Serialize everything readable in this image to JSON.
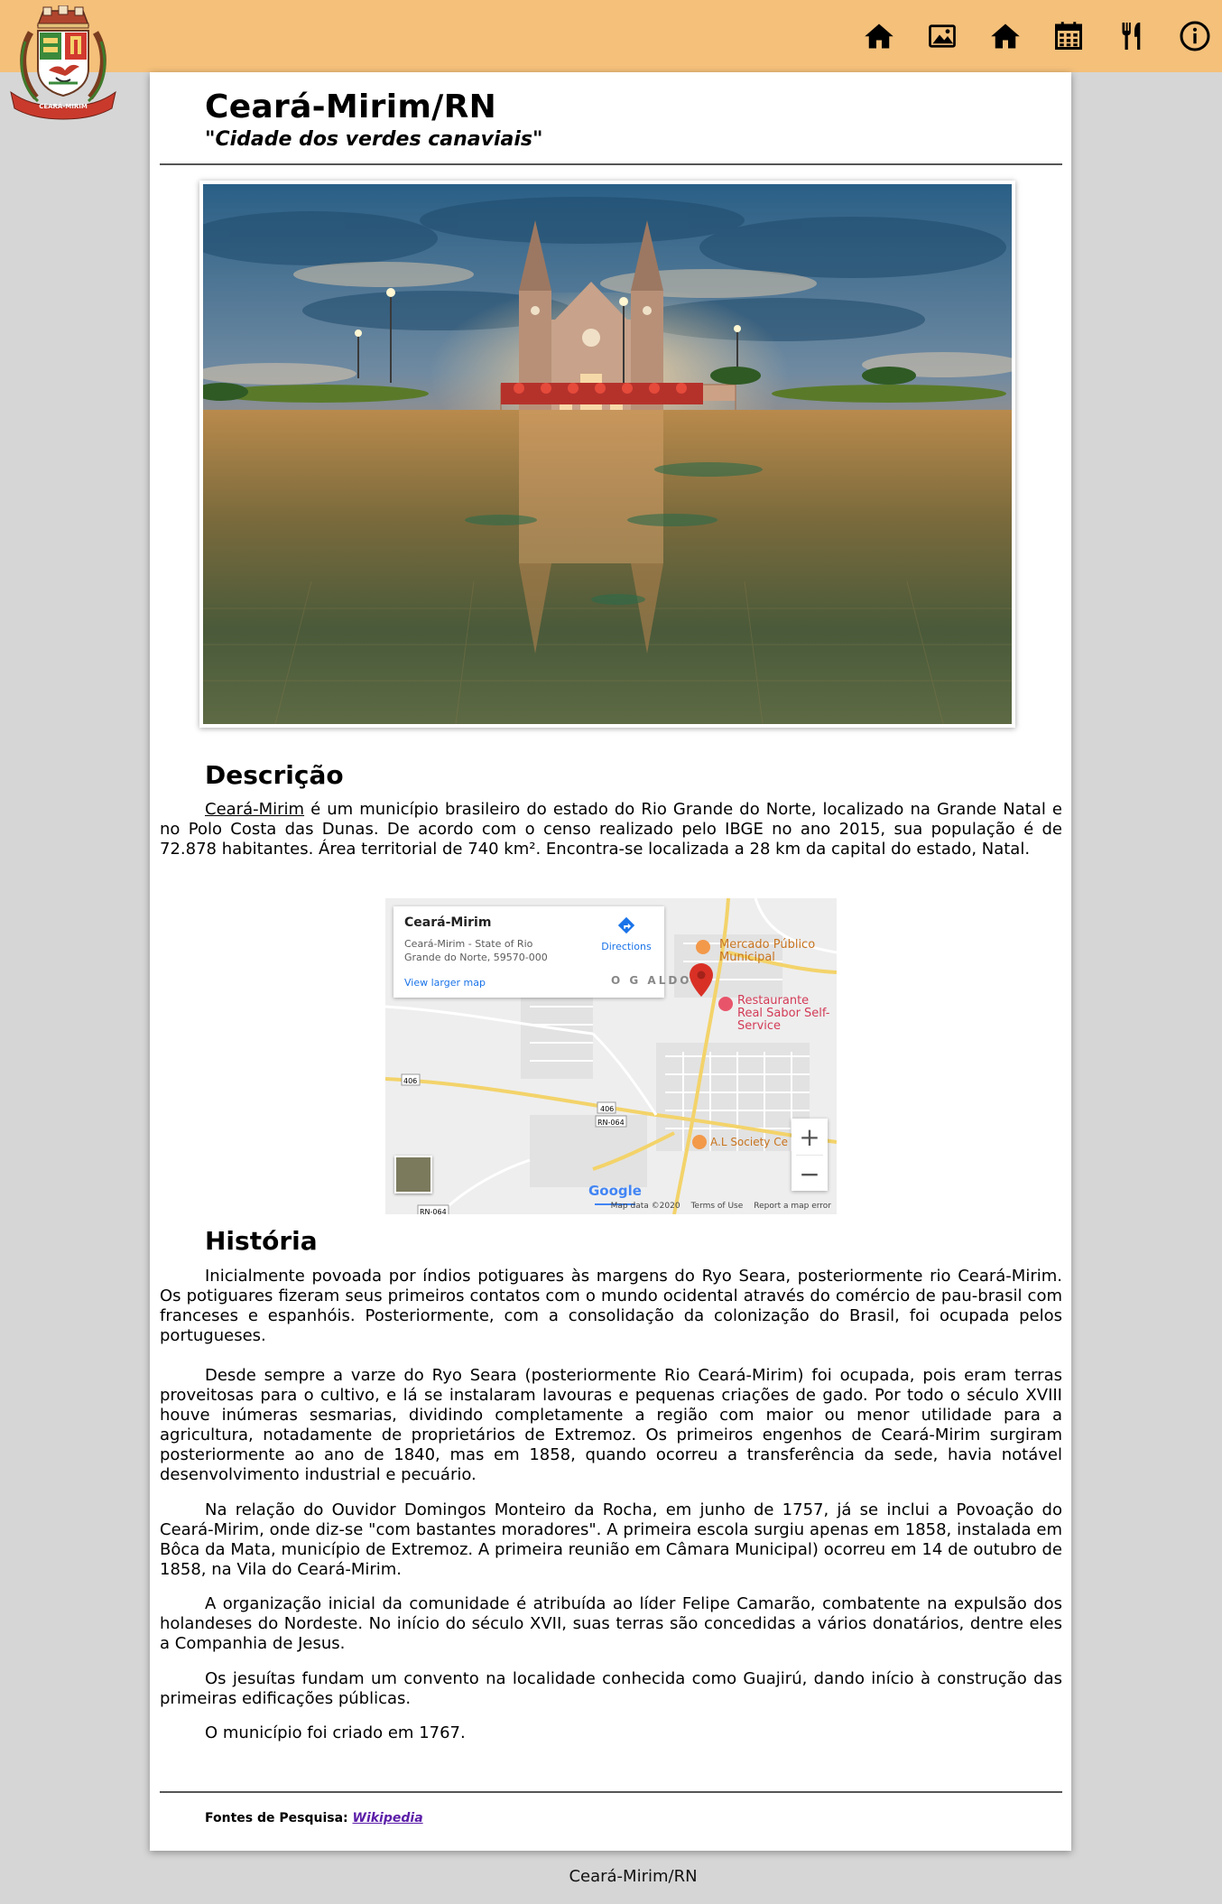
{
  "header": {
    "logo_name": "brasão de Ceará-Mirim",
    "logo_ribbon": "CEARÁ-MIRIM",
    "nav": [
      {
        "name": "home-icon"
      },
      {
        "name": "gallery-icon"
      },
      {
        "name": "home-icon"
      },
      {
        "name": "calendar-icon"
      },
      {
        "name": "restaurant-icon"
      },
      {
        "name": "info-icon"
      }
    ],
    "bar_color": "#f4c07a"
  },
  "page": {
    "title": "Ceará-Mirim/RN",
    "subtitle": "\"Cidade dos verdes canaviais\""
  },
  "descricao": {
    "heading": "Descrição",
    "link_text": "Ceará-Mirim",
    "text": " é um município brasileiro do estado do Rio Grande do Norte, localizado na Grande Natal e no Polo Costa das Dunas. De acordo com o censo realizado pelo IBGE no ano 2015, sua população é de 72.878 habitantes. Área territorial de 740 km². Encontra-se localizada a 28 km da capital do estado, Natal."
  },
  "map": {
    "place": "Ceará-Mirim",
    "address": "Ceará-Mirim - State of Rio Grande do Norte, 59570-000",
    "directions": "Directions",
    "larger_map": "View larger map",
    "poi_1": "Mercado Público Municipal",
    "poi_2": "Restaurante Real Sabor Self-Service",
    "poi_3": "A.L Society Ce",
    "neighborhood": "O G   ALDO",
    "road_1": "406",
    "road_2": "406",
    "road_3": "RN-064",
    "road_4": "RN-064",
    "zoom_in": "+",
    "zoom_out": "−",
    "google": "Google",
    "map_data": "Map data ©2020",
    "terms": "Terms of Use",
    "report": "Report a map error"
  },
  "historia": {
    "heading": "História",
    "paragraphs": [
      "Inicialmente povoada por índios potiguares às margens do Ryo Seara, posteriormente rio Ceará-Mirim. Os potiguares fizeram seus primeiros contatos com o mundo ocidental através do comércio de pau-brasil com franceses e espanhóis. Posteriormente, com a consolidação da colonização do Brasil, foi ocupada pelos portugueses.",
      "Desde sempre a varze do Ryo Seara (posteriormente Rio Ceará-Mirim) foi ocupada, pois eram terras proveitosas para o cultivo, e lá se instalaram lavouras e pequenas criações de gado. Por todo o século XVIII houve inúmeras sesmarias, dividindo completamente a região com maior ou menor utilidade para a agricultura, notadamente de proprietários de Extremoz. Os primeiros engenhos de Ceará-Mirim surgiram posteriormente ao ano de 1840, mas em 1858, quando ocorreu a transferência da sede, havia notável desenvolvimento industrial e pecuário.",
      "Na relação do Ouvidor Domingos Monteiro da Rocha, em junho de 1757, já se inclui a Povoação do Ceará-Mirim, onde diz-se \"com bastantes moradores\". A primeira escola surgiu apenas em 1858, instalada em Bôca da Mata, município de Extremoz. A primeira reunião em Câmara Municipal) ocorreu em 14 de outubro de 1858, na Vila do Ceará-Mirim.",
      "A organização inicial da comunidade é atribuída ao líder Felipe Camarão, combatente na expulsão dos holandeses do Nordeste. No início do século XVII, suas terras são concedidas a vários donatários, dentre eles a Companhia de Jesus.",
      "Os jesuítas fundam um convento na localidade conhecida como Guajirú, dando início à construção das primeiras edificações públicas.",
      "O município foi criado em 1767."
    ]
  },
  "footer": {
    "sources_label": "Fontes de Pesquisa:",
    "sources_link": "Wikipedia",
    "bottom_label": "Ceará-Mirim/RN"
  }
}
